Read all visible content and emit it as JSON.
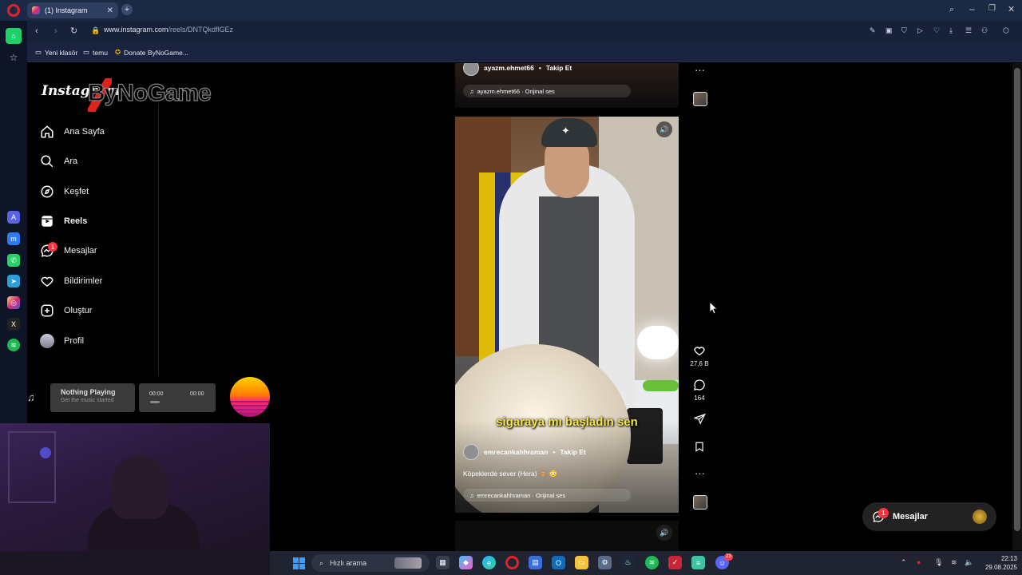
{
  "browser": {
    "tab_title": "(1) Instagram",
    "url_domain": "www.instagram.com",
    "url_path": "/reels/DNTQkdflGEz",
    "bookmarks": [
      {
        "label": "Yeni klasör"
      },
      {
        "label": "temu"
      },
      {
        "label": "Donate ByNoGame..."
      }
    ],
    "colors": {
      "tabbar": "#1b2a44",
      "accent_home": "#1fd06a"
    }
  },
  "sidebar": {
    "logo": "Instagram",
    "watermark": "ByNoGame",
    "items": [
      {
        "label": "Ana Sayfa",
        "icon": "home-icon"
      },
      {
        "label": "Ara",
        "icon": "search-icon"
      },
      {
        "label": "Keşfet",
        "icon": "compass-icon"
      },
      {
        "label": "Reels",
        "icon": "reels-icon"
      },
      {
        "label": "Mesajlar",
        "icon": "messenger-icon",
        "badge": "1"
      },
      {
        "label": "Bildirimler",
        "icon": "heart-icon"
      },
      {
        "label": "Oluştur",
        "icon": "plus-square-icon"
      },
      {
        "label": "Profil",
        "icon": "avatar"
      }
    ]
  },
  "music_widget": {
    "title": "Nothing Playing",
    "subtitle": "Get the music started",
    "time_current": "00:00",
    "time_total": "00:00"
  },
  "reel_previous": {
    "username": "ayazm.ehmet66",
    "follow": "Takip Et",
    "audio": "ayazm.ehmet66 · Orijinal ses"
  },
  "reel_current": {
    "caption_overlay": "sigaraya mı başladın sen",
    "username": "emrecankahhraman",
    "follow": "Takip Et",
    "description": "Köpeklerde sever (Hera) 🙈 😳",
    "audio": "emrecankahhraman · Orijinal ses",
    "likes": "27,6 B",
    "comments": "164"
  },
  "messages_pill": {
    "label": "Mesajlar",
    "badge": "1"
  },
  "taskbar": {
    "search_placeholder": "Hızlı arama",
    "time": "22:13",
    "date": "29.08.2025",
    "discord_badge": "23"
  }
}
